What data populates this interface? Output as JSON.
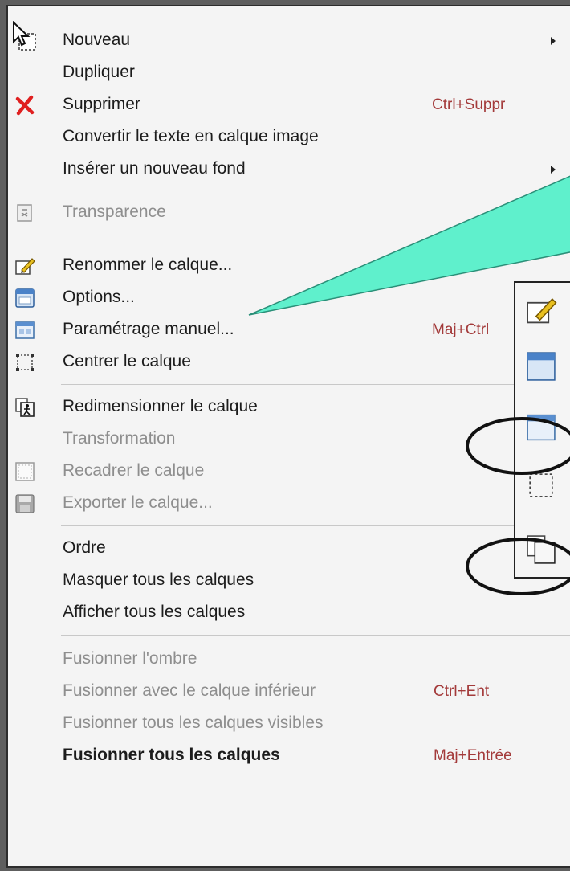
{
  "menu": {
    "items": [
      {
        "label": "Nouveau",
        "shortcut": "",
        "submenu": true,
        "disabled": false,
        "icon": "cursor-icon"
      },
      {
        "label": "Dupliquer",
        "shortcut": "",
        "submenu": false,
        "disabled": false,
        "icon": ""
      },
      {
        "label": "Supprimer",
        "shortcut": "Ctrl+Suppr",
        "submenu": false,
        "disabled": false,
        "icon": "delete-x-icon"
      },
      {
        "label": "Convertir le texte en calque image",
        "shortcut": "",
        "submenu": false,
        "disabled": false,
        "icon": ""
      },
      {
        "label": "Insérer un nouveau fond",
        "shortcut": "",
        "submenu": true,
        "disabled": false,
        "icon": ""
      },
      {
        "label": "Transparence",
        "shortcut": "",
        "submenu": true,
        "disabled": true,
        "icon": "transparency-icon"
      },
      {
        "label": "Renommer le calque...",
        "shortcut": "",
        "submenu": false,
        "disabled": false,
        "icon": "rename-pencil-icon"
      },
      {
        "label": "Options...",
        "shortcut": "",
        "submenu": false,
        "disabled": false,
        "icon": "options-window-icon"
      },
      {
        "label": "Paramétrage manuel...",
        "shortcut": "Maj+Ctrl",
        "submenu": false,
        "disabled": false,
        "icon": "manual-settings-icon"
      },
      {
        "label": "Centrer le calque",
        "shortcut": "",
        "submenu": false,
        "disabled": false,
        "icon": "center-layer-icon"
      },
      {
        "label": "Redimensionner le calque",
        "shortcut": "",
        "submenu": false,
        "disabled": false,
        "icon": "resize-layer-icon"
      },
      {
        "label": "Transformation",
        "shortcut": "",
        "submenu": false,
        "disabled": true,
        "icon": ""
      },
      {
        "label": "Recadrer le calque",
        "shortcut": "",
        "submenu": false,
        "disabled": true,
        "icon": "crop-layer-icon"
      },
      {
        "label": "Exporter le calque...",
        "shortcut": "",
        "submenu": false,
        "disabled": true,
        "icon": "save-disk-icon"
      },
      {
        "label": "Ordre",
        "shortcut": "",
        "submenu": false,
        "disabled": false,
        "icon": ""
      },
      {
        "label": "Masquer tous les calques",
        "shortcut": "",
        "submenu": false,
        "disabled": false,
        "icon": ""
      },
      {
        "label": "Afficher tous les calques",
        "shortcut": "",
        "submenu": false,
        "disabled": false,
        "icon": ""
      },
      {
        "label": "Fusionner l'ombre",
        "shortcut": "",
        "submenu": false,
        "disabled": true,
        "icon": ""
      },
      {
        "label": "Fusionner avec le calque inférieur",
        "shortcut": "Ctrl+Ent",
        "submenu": false,
        "disabled": true,
        "icon": ""
      },
      {
        "label": "Fusionner tous les calques visibles",
        "shortcut": "",
        "submenu": false,
        "disabled": true,
        "icon": ""
      },
      {
        "label": "Fusionner tous les calques",
        "shortcut": "Maj+Entrée",
        "submenu": false,
        "disabled": false,
        "icon": ""
      }
    ]
  },
  "colors": {
    "callout_fill": "#5ff0cc",
    "shortcut_text": "#a33a3a",
    "disabled_text": "#8e8e8e",
    "delete_red": "#e02020"
  }
}
